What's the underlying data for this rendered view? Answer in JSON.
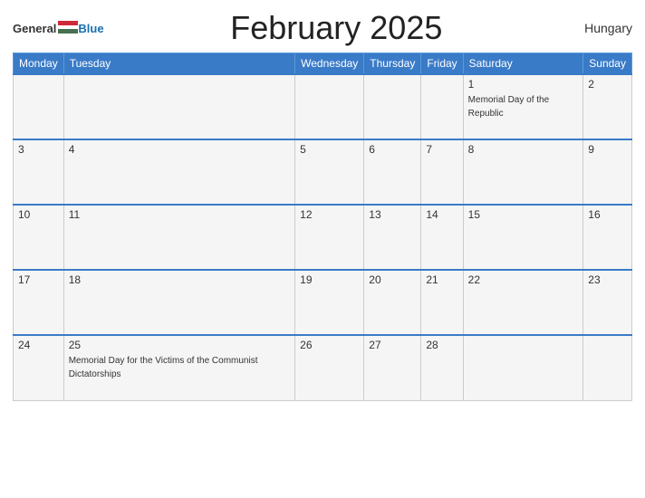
{
  "header": {
    "logo_general": "General",
    "logo_blue": "Blue",
    "title": "February 2025",
    "country": "Hungary"
  },
  "days_of_week": [
    "Monday",
    "Tuesday",
    "Wednesday",
    "Thursday",
    "Friday",
    "Saturday",
    "Sunday"
  ],
  "weeks": [
    [
      {
        "day": "",
        "event": ""
      },
      {
        "day": "",
        "event": ""
      },
      {
        "day": "",
        "event": ""
      },
      {
        "day": "",
        "event": ""
      },
      {
        "day": "",
        "event": ""
      },
      {
        "day": "1",
        "event": "Memorial Day of the Republic"
      },
      {
        "day": "2",
        "event": ""
      }
    ],
    [
      {
        "day": "3",
        "event": ""
      },
      {
        "day": "4",
        "event": ""
      },
      {
        "day": "5",
        "event": ""
      },
      {
        "day": "6",
        "event": ""
      },
      {
        "day": "7",
        "event": ""
      },
      {
        "day": "8",
        "event": ""
      },
      {
        "day": "9",
        "event": ""
      }
    ],
    [
      {
        "day": "10",
        "event": ""
      },
      {
        "day": "11",
        "event": ""
      },
      {
        "day": "12",
        "event": ""
      },
      {
        "day": "13",
        "event": ""
      },
      {
        "day": "14",
        "event": ""
      },
      {
        "day": "15",
        "event": ""
      },
      {
        "day": "16",
        "event": ""
      }
    ],
    [
      {
        "day": "17",
        "event": ""
      },
      {
        "day": "18",
        "event": ""
      },
      {
        "day": "19",
        "event": ""
      },
      {
        "day": "20",
        "event": ""
      },
      {
        "day": "21",
        "event": ""
      },
      {
        "day": "22",
        "event": ""
      },
      {
        "day": "23",
        "event": ""
      }
    ],
    [
      {
        "day": "24",
        "event": ""
      },
      {
        "day": "25",
        "event": "Memorial Day for the Victims of the Communist Dictatorships"
      },
      {
        "day": "26",
        "event": ""
      },
      {
        "day": "27",
        "event": ""
      },
      {
        "day": "28",
        "event": ""
      },
      {
        "day": "",
        "event": ""
      },
      {
        "day": "",
        "event": ""
      }
    ]
  ]
}
